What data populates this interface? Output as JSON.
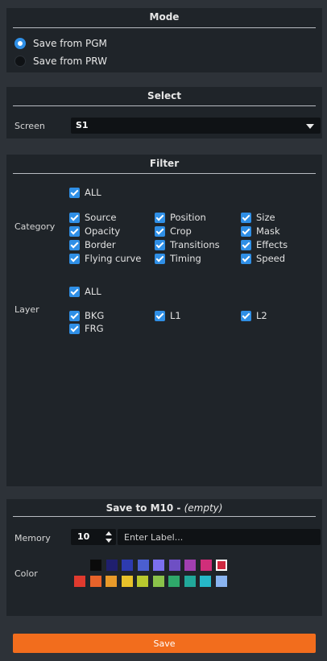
{
  "mode": {
    "title": "Mode",
    "options": [
      {
        "label": "Save from PGM",
        "selected": true
      },
      {
        "label": "Save from PRW",
        "selected": false
      }
    ]
  },
  "select": {
    "title": "Select",
    "screen_label": "Screen",
    "screen_value": "S1"
  },
  "filter": {
    "title": "Filter",
    "category_label": "Category",
    "category_all": "ALL",
    "categories": [
      "Source",
      "Position",
      "Size",
      "Opacity",
      "Crop",
      "Mask",
      "Border",
      "Transitions",
      "Effects",
      "Flying curve",
      "Timing",
      "Speed"
    ],
    "layer_label": "Layer",
    "layer_all": "ALL",
    "layers": [
      "BKG",
      "L1",
      "L2",
      "FRG"
    ]
  },
  "save": {
    "title_main": "Save to M10 - ",
    "title_sub": "(empty)",
    "memory_label": "Memory",
    "memory_value": "10",
    "label_placeholder": "Enter Label...",
    "color_label": "Color",
    "colors_row1": [
      "#0b0b0b",
      "#1f1f6e",
      "#2d3bb0",
      "#4b5fd0",
      "#7b6ff0",
      "#6e4fc4",
      "#a13fb0",
      "#d02e7a",
      "#d0283f"
    ],
    "colors_row2": [
      "#e03a2e",
      "#e8632a",
      "#e89a2a",
      "#e8c22a",
      "#b8c82e",
      "#8bc24a",
      "#2fa86a",
      "#21a89a",
      "#26b8c8",
      "#8ab4f0"
    ],
    "selected_color": "#d0283f",
    "button_label": "Save"
  }
}
